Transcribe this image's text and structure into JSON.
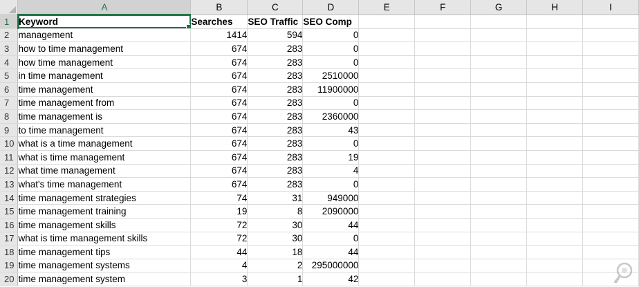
{
  "columns": [
    "A",
    "B",
    "C",
    "D",
    "E",
    "F",
    "G",
    "H",
    "I"
  ],
  "row_numbers": [
    "1",
    "2",
    "3",
    "4",
    "5",
    "6",
    "7",
    "8",
    "9",
    "10",
    "11",
    "12",
    "13",
    "14",
    "15",
    "16",
    "17",
    "18",
    "19",
    "20"
  ],
  "header_row": {
    "keyword": "Keyword",
    "searches": "Searches",
    "seo_traffic": "SEO Traffic",
    "seo_comp": "SEO Comp"
  },
  "data_rows": [
    {
      "keyword": "management",
      "searches": "1414",
      "seo_traffic": "594",
      "seo_comp": "0"
    },
    {
      "keyword": "how to time management",
      "searches": "674",
      "seo_traffic": "283",
      "seo_comp": "0"
    },
    {
      "keyword": "how time management",
      "searches": "674",
      "seo_traffic": "283",
      "seo_comp": "0"
    },
    {
      "keyword": "in time management",
      "searches": "674",
      "seo_traffic": "283",
      "seo_comp": "2510000"
    },
    {
      "keyword": "time management",
      "searches": "674",
      "seo_traffic": "283",
      "seo_comp": "11900000"
    },
    {
      "keyword": "time management from",
      "searches": "674",
      "seo_traffic": "283",
      "seo_comp": "0"
    },
    {
      "keyword": "time management is",
      "searches": "674",
      "seo_traffic": "283",
      "seo_comp": "2360000"
    },
    {
      "keyword": "to time management",
      "searches": "674",
      "seo_traffic": "283",
      "seo_comp": "43"
    },
    {
      "keyword": "what is a time management",
      "searches": "674",
      "seo_traffic": "283",
      "seo_comp": "0"
    },
    {
      "keyword": "what is time management",
      "searches": "674",
      "seo_traffic": "283",
      "seo_comp": "19"
    },
    {
      "keyword": "what time management",
      "searches": "674",
      "seo_traffic": "283",
      "seo_comp": "4"
    },
    {
      "keyword": "what's time management",
      "searches": "674",
      "seo_traffic": "283",
      "seo_comp": "0"
    },
    {
      "keyword": "time management strategies",
      "searches": "74",
      "seo_traffic": "31",
      "seo_comp": "949000"
    },
    {
      "keyword": "time management training",
      "searches": "19",
      "seo_traffic": "8",
      "seo_comp": "2090000"
    },
    {
      "keyword": "time management skills",
      "searches": "72",
      "seo_traffic": "30",
      "seo_comp": "44"
    },
    {
      "keyword": "what is time management skills",
      "searches": "72",
      "seo_traffic": "30",
      "seo_comp": "0"
    },
    {
      "keyword": "time management tips",
      "searches": "44",
      "seo_traffic": "18",
      "seo_comp": "44"
    },
    {
      "keyword": "time management systems",
      "searches": "4",
      "seo_traffic": "2",
      "seo_comp": "295000000"
    },
    {
      "keyword": "time management system",
      "searches": "3",
      "seo_traffic": "1",
      "seo_comp": "42"
    }
  ],
  "selection": {
    "active_cell": "A1",
    "active_column": "A",
    "active_row": "1"
  },
  "colors": {
    "accent": "#217346",
    "header_bg": "#e6e6e6",
    "gridline": "#dadada"
  },
  "icons": {
    "corner": "select-all-triangle",
    "watermark": "magnifier-logo-icon"
  }
}
